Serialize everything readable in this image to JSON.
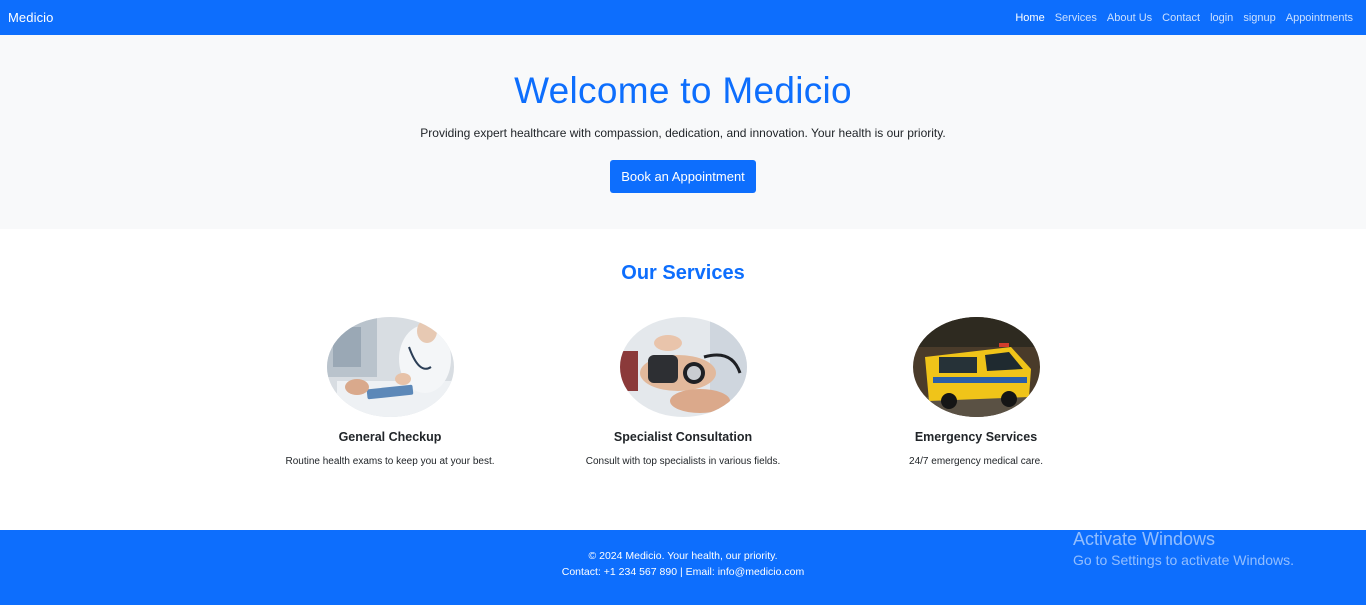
{
  "navbar": {
    "brand": "Medicio",
    "links": [
      {
        "label": "Home"
      },
      {
        "label": "Services"
      },
      {
        "label": "About Us"
      },
      {
        "label": "Contact"
      },
      {
        "label": "login"
      },
      {
        "label": "signup"
      },
      {
        "label": "Appointments"
      }
    ]
  },
  "hero": {
    "title": "Welcome to Medicio",
    "subtitle": "Providing expert healthcare with compassion, dedication, and innovation. Your health is our priority.",
    "cta_label": "Book an Appointment"
  },
  "services": {
    "heading": "Our Services",
    "cards": [
      {
        "title": "General Checkup",
        "description": "Routine health exams to keep you at your best."
      },
      {
        "title": "Specialist Consultation",
        "description": "Consult with top specialists in various fields."
      },
      {
        "title": "Emergency Services",
        "description": "24/7 emergency medical care."
      }
    ]
  },
  "footer": {
    "line1": "© 2024 Medicio. Your health, our priority.",
    "line2": "Contact: +1 234 567 890 | Email: info@medicio.com"
  },
  "watermark": {
    "title": "Activate Windows",
    "subtitle": "Go to Settings to activate Windows."
  },
  "colors": {
    "primary": "#0d6efd",
    "hero_bg": "#f8f9fa"
  }
}
